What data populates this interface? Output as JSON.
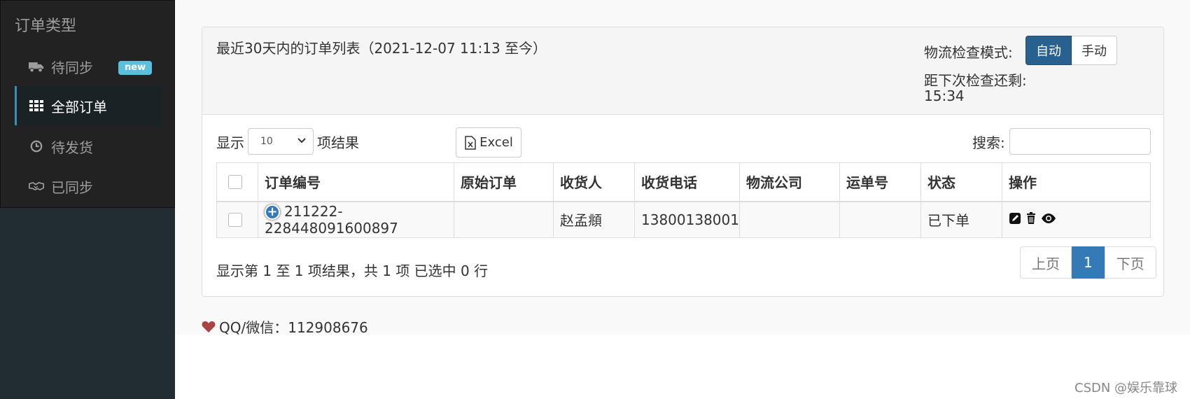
{
  "sidebar": {
    "title": "订单类型",
    "items": [
      {
        "label": "待同步",
        "icon": "truck-icon",
        "badge": "new"
      },
      {
        "label": "全部订单",
        "icon": "grid-icon"
      },
      {
        "label": "待发货",
        "icon": "clock-icon"
      },
      {
        "label": "已同步",
        "icon": "handshake-icon"
      }
    ]
  },
  "panel": {
    "title": "最近30天内的订单列表（2021-12-07 11:13 至今）",
    "mode_label": "物流检查模式:",
    "mode_options": [
      "自动",
      "手动"
    ],
    "mode_selected": "自动",
    "countdown_label": "距下次检查还剩:",
    "countdown_time": "15:34"
  },
  "controls": {
    "show_label": "显示",
    "page_length": "10",
    "result_label": "项结果",
    "excel_label": "Excel",
    "search_label": "搜索:",
    "search_value": ""
  },
  "table": {
    "headers": [
      "订单编号",
      "原始订单",
      "收货人",
      "收货电话",
      "物流公司",
      "运单号",
      "状态",
      "操作"
    ],
    "rows": [
      {
        "order_no": "211222-228448091600897",
        "original": "",
        "receiver": "赵孟頫",
        "phone": "13800138001",
        "logistics": "",
        "waybill": "",
        "status": "已下单"
      }
    ]
  },
  "info": "显示第 1 至 1 项结果，共 1 项    已选中 0 行",
  "pagination": {
    "prev": "上页",
    "current": "1",
    "next": "下页"
  },
  "footer": {
    "contact": "QQ/微信：112908676"
  },
  "watermark": "CSDN @娱乐靠球",
  "colors": {
    "primary": "#286090",
    "accent": "#337ab7",
    "badge": "#5bc0de",
    "heart": "#a94442"
  }
}
